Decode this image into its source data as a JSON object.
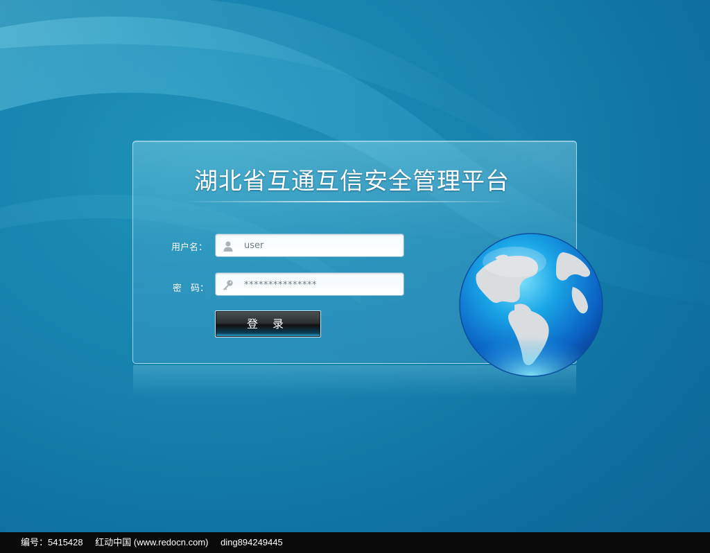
{
  "title": "湖北省互通互信安全管理平台",
  "form": {
    "username_label": "用户名：",
    "username_value": "user",
    "password_label": "密　码：",
    "password_value": "***************",
    "login_label": "登 录"
  },
  "icons": {
    "username": "user-icon",
    "password": "key-icon",
    "decoration": "globe-icon"
  },
  "footer": {
    "id_text": "编号：5415428",
    "site_text": "红动中国 (www.redocn.com)",
    "author_text": "ding894249445"
  },
  "colors": {
    "background": "#1580ab",
    "footer": "#0a0a0a",
    "panel_border": "#c8ebfa"
  }
}
